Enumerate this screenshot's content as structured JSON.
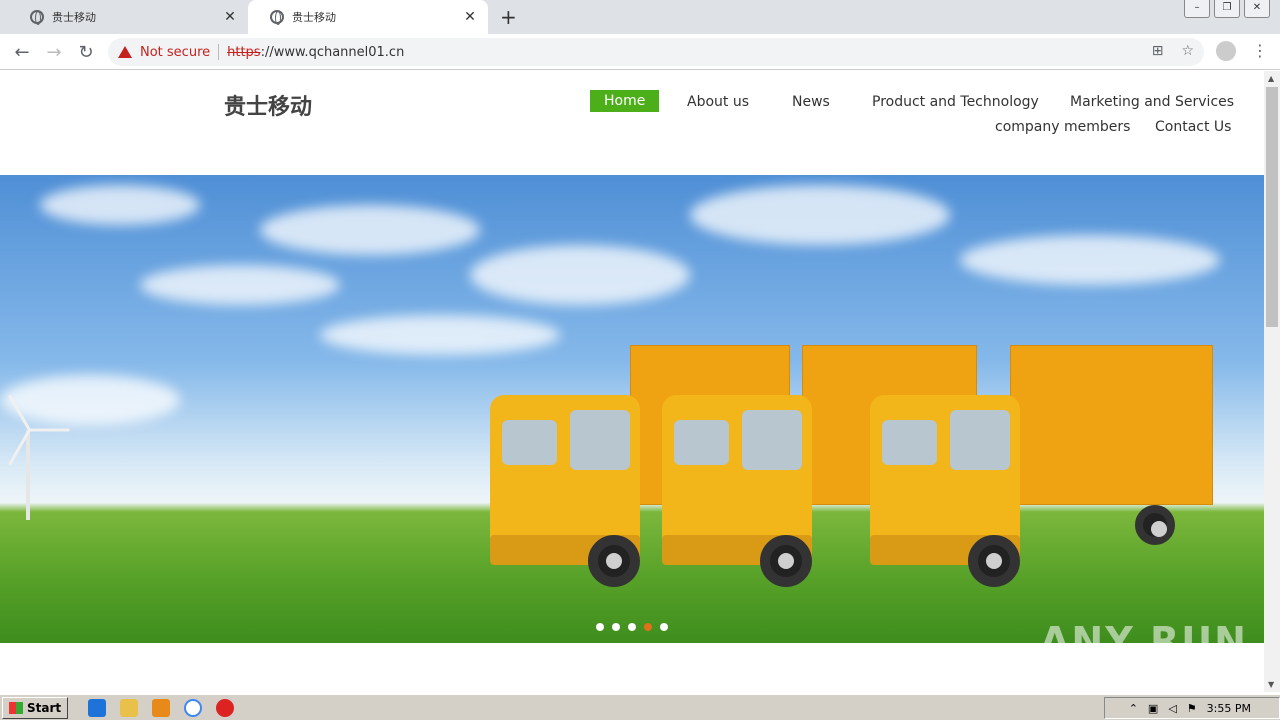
{
  "browser": {
    "tabs": [
      {
        "title": "贵士移动",
        "active": false
      },
      {
        "title": "贵士移动",
        "active": true
      }
    ],
    "new_tab": "+",
    "address": {
      "security_label": "Not secure",
      "scheme": "https",
      "rest": "://www.qchannel01.cn"
    }
  },
  "site": {
    "logo": "贵士移动",
    "nav": [
      {
        "label": "Home",
        "active": true
      },
      {
        "label": "About us"
      },
      {
        "label": "News"
      },
      {
        "label": "Product and Technology"
      },
      {
        "label": "Marketing and Services"
      },
      {
        "label": "company members"
      },
      {
        "label": "Contact Us"
      }
    ],
    "slider": {
      "count": 5,
      "active_index": 3
    }
  },
  "watermark": "ANY RUN",
  "taskbar": {
    "start_label": "Start",
    "clock": "3:55 PM"
  }
}
